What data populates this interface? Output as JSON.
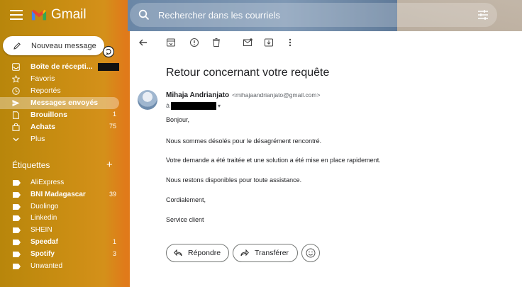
{
  "app": {
    "name": "Gmail"
  },
  "search": {
    "placeholder": "Rechercher dans les courriels"
  },
  "compose": {
    "label": "Nouveau message"
  },
  "nav": [
    {
      "label": "Boîte de récepti...",
      "count": "",
      "bold": true,
      "icon": "inbox-icon",
      "redacted_count": true
    },
    {
      "label": "Favoris",
      "count": "",
      "bold": false,
      "icon": "star-icon"
    },
    {
      "label": "Reportés",
      "count": "",
      "bold": false,
      "icon": "clock-icon"
    },
    {
      "label": "Messages envoyés",
      "count": "",
      "bold": true,
      "icon": "send-icon",
      "active": true
    },
    {
      "label": "Brouillons",
      "count": "1",
      "bold": true,
      "icon": "draft-icon"
    },
    {
      "label": "Achats",
      "count": "75",
      "bold": true,
      "icon": "shopping-bag-icon"
    },
    {
      "label": "Plus",
      "count": "",
      "bold": false,
      "icon": "chevron-down-icon"
    }
  ],
  "labels_section": {
    "title": "Étiquettes"
  },
  "labels": [
    {
      "label": "AliExpress",
      "count": "",
      "bold": false
    },
    {
      "label": "BNI Madagascar",
      "count": "39",
      "bold": true
    },
    {
      "label": "Duolingo",
      "count": "",
      "bold": false
    },
    {
      "label": "Linkedin",
      "count": "",
      "bold": false
    },
    {
      "label": "SHEIN",
      "count": "",
      "bold": false
    },
    {
      "label": "Speedaf",
      "count": "1",
      "bold": true
    },
    {
      "label": "Spotify",
      "count": "3",
      "bold": true
    },
    {
      "label": "Unwanted",
      "count": "",
      "bold": false
    }
  ],
  "message": {
    "subject": "Retour concernant votre requête",
    "sender_name": "Mihaja Andrianjato",
    "sender_email": "<mihajaandrianjato@gmail.com>",
    "to_prefix": "à",
    "body": [
      "Bonjour,",
      "Nous sommes désolés pour le désagrément rencontré.",
      "Votre demande a été traitée et une solution a été mise en place rapidement.",
      "Nous restons disponibles pour toute assistance.",
      "Cordialement,",
      "Service client"
    ]
  },
  "actions": {
    "reply": "Répondre",
    "forward": "Transférer"
  }
}
